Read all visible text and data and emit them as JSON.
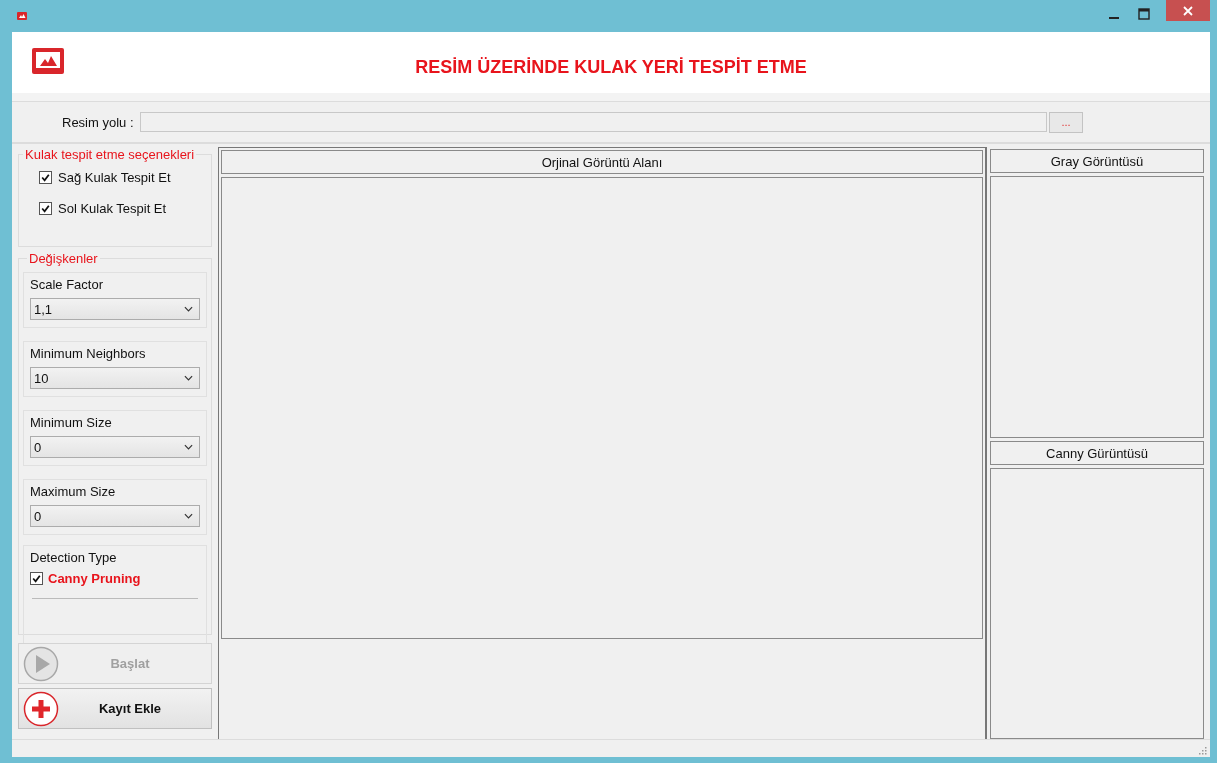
{
  "header": {
    "title": "RESİM ÜZERİNDE KULAK YERİ TESPİT ETME"
  },
  "path": {
    "label": "Resim yolu :",
    "browse_button": "..."
  },
  "ear_options": {
    "title": "Kulak tespit etme seçenekleri",
    "items": [
      {
        "label": "Sağ Kulak Tespit Et",
        "checked": true
      },
      {
        "label": "Sol Kulak Tespit Et",
        "checked": true
      }
    ]
  },
  "variables": {
    "title": "Değişkenler",
    "fields": [
      {
        "label": "Scale Factor",
        "value": "1,1"
      },
      {
        "label": "Minimum Neighbors",
        "value": "10"
      },
      {
        "label": "Minimum Size",
        "value": "0"
      },
      {
        "label": "Maximum Size",
        "value": "0"
      }
    ],
    "detection": {
      "label": "Detection Type",
      "option": "Canny Pruning",
      "checked": true
    }
  },
  "buttons": [
    {
      "label": "Başlat",
      "kind": "play",
      "disabled": true
    },
    {
      "label": "Kayıt Ekle",
      "kind": "add",
      "disabled": false
    }
  ],
  "panels": {
    "original": "Orjinal Görüntü Alanı",
    "gray": "Gray Görüntüsü",
    "canny": "Canny Gürüntüsü"
  }
}
